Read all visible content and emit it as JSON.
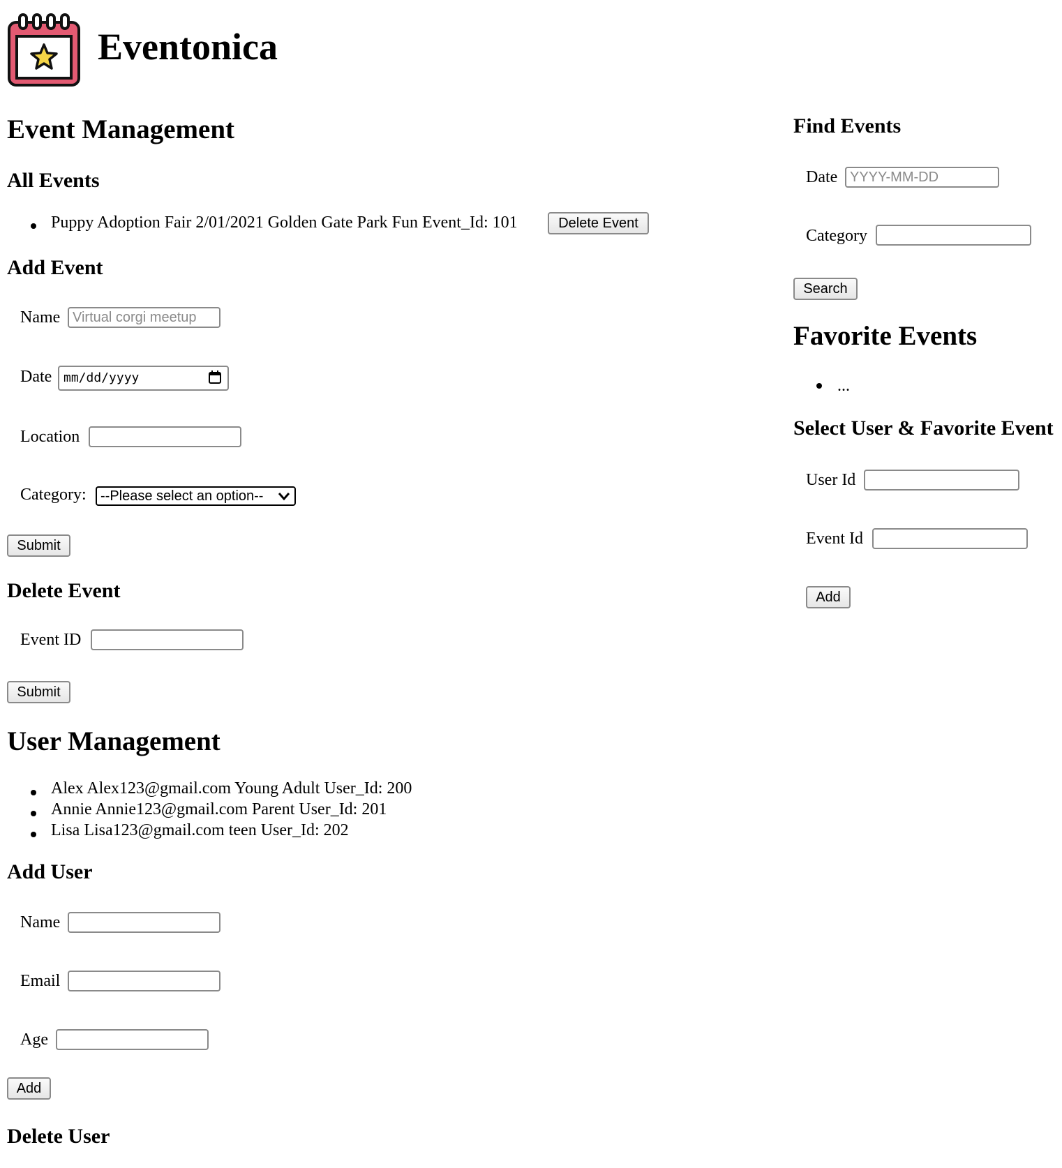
{
  "app": {
    "title": "Eventonica",
    "logo_icon": "calendar-star-icon",
    "accent": "#e35a72",
    "star_color": "#f5d547"
  },
  "event_management": {
    "heading": "Event Management",
    "all_events": {
      "heading": "All Events",
      "items": [
        {
          "text": "Puppy Adoption Fair 2/01/2021 Golden Gate Park Fun Event_Id: 101",
          "delete_label": "Delete Event"
        }
      ]
    },
    "add_event": {
      "heading": "Add Event",
      "name_label": "Name",
      "name_placeholder": "Virtual corgi meetup",
      "date_label": "Date",
      "date_display": "mm/dd/yyyy",
      "location_label": "Location",
      "category_label": "Category:",
      "category_selected": "--Please select an option--",
      "submit_label": "Submit"
    },
    "delete_event": {
      "heading": "Delete Event",
      "id_label": "Event ID",
      "submit_label": "Submit"
    }
  },
  "user_management": {
    "heading": "User Management",
    "users": [
      "Alex Alex123@gmail.com Young Adult User_Id: 200",
      "Annie Annie123@gmail.com Parent User_Id: 201",
      "Lisa Lisa123@gmail.com teen User_Id: 202"
    ],
    "add_user": {
      "heading": "Add User",
      "name_label": "Name",
      "email_label": "Email",
      "age_label": "Age",
      "add_label": "Add"
    },
    "delete_user": {
      "heading": "Delete User"
    }
  },
  "find_events": {
    "heading": "Find Events",
    "date_label": "Date",
    "date_placeholder": "YYYY-MM-DD",
    "category_label": "Category",
    "search_label": "Search"
  },
  "favorite_events": {
    "heading": "Favorite Events",
    "items": [
      "..."
    ]
  },
  "select_favorite": {
    "heading": "Select User & Favorite Event",
    "user_id_label": "User Id",
    "event_id_label": "Event Id",
    "add_label": "Add"
  }
}
